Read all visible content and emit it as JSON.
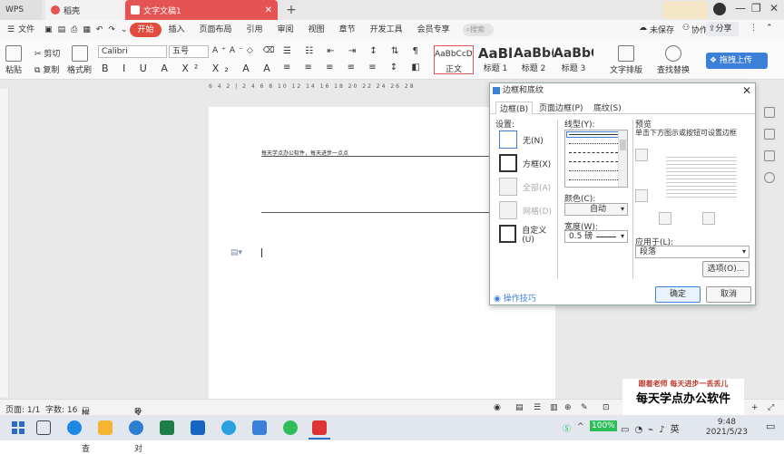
{
  "titlebar": {
    "tabs": [
      {
        "label": "WPS"
      },
      {
        "label": "稻壳"
      },
      {
        "label": "文字文稿1"
      }
    ]
  },
  "menu": {
    "file": "文件",
    "items": [
      "开始",
      "插入",
      "页面布局",
      "引用",
      "审阅",
      "视图",
      "章节",
      "开发工具",
      "会员专享"
    ],
    "search": "搜索",
    "unsaved": "未保存",
    "collab": "协作",
    "share": "分享"
  },
  "ribbon": {
    "paste": "粘贴",
    "cut": "剪切",
    "copy": "复制",
    "format_painter": "格式刷",
    "font_name": "Calibri",
    "font_size": "五号",
    "styles": [
      {
        "sample": "AaBbCcDd",
        "label": "正文"
      },
      {
        "sample": "AaBl",
        "label": "标题 1"
      },
      {
        "sample": "AaBb(",
        "label": "标题 2"
      },
      {
        "sample": "AaBbC",
        "label": "标题 3"
      }
    ],
    "text_layout": "文字排版",
    "find_replace": "查找替换",
    "cloud_upload": "拖拽上传"
  },
  "ruler": {
    "ticks": "6 4 2 | 2 4 6 8 10 12 14 16 18 20 22 24 26 28"
  },
  "document": {
    "line1": "每天学点办公软件，每天进步一点点"
  },
  "dialog": {
    "title": "边框和底纹",
    "tabs": [
      "边框(B)",
      "页面边框(P)",
      "底纹(S)"
    ],
    "settings_label": "设置:",
    "settings": [
      {
        "label": "无(N)"
      },
      {
        "label": "方框(X)"
      },
      {
        "label": "全部(A)"
      },
      {
        "label": "网格(D)"
      },
      {
        "label": "自定义(U)"
      }
    ],
    "line_type_label": "线型(Y):",
    "color_label": "颜色(C):",
    "color_value": "自动",
    "width_label": "宽度(W):",
    "width_value": "0.5  磅",
    "preview_label": "预览",
    "preview_hint": "单击下方图示或按钮可设置边框",
    "apply_label": "应用于(L):",
    "apply_value": "段落",
    "options_button": "选项(O)...",
    "tips": "操作技巧",
    "ok": "确定",
    "cancel": "取消"
  },
  "statusbar": {
    "page": "页面: 1/1",
    "words": "字数: 16",
    "spell": "拼写检查",
    "proof": "文档校对"
  },
  "taskbar": {
    "battery": "100%",
    "time": "9:48",
    "date": "2021/5/23"
  },
  "watermark": {
    "line1": "跟着老师  每天进步一丢丢儿",
    "line2": "每天学点办公软件"
  },
  "colors": {
    "accent": "#e24c3c",
    "dialog_primary": "#3b7fd8"
  }
}
